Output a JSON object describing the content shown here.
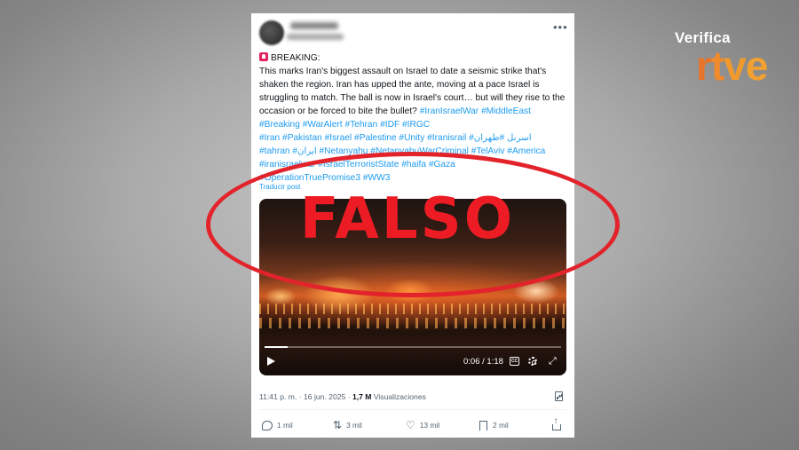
{
  "brand": {
    "verifica": "Verifica",
    "rtve_parts": [
      {
        "text": "r",
        "color": "#e8742a"
      },
      {
        "text": "t",
        "color": "#ef8a2d"
      },
      {
        "text": "v",
        "color": "#f09a2e"
      },
      {
        "text": "e",
        "color": "#f2a030"
      }
    ]
  },
  "tweet": {
    "breaking": "BREAKING:",
    "body": "This marks Iran's biggest assault on Israel to date  a seismic strike that's shaken the region. Iran has upped the ante, moving at a pace Israel is struggling to match. The ball is now in Israel's court… but will they rise to the occasion or be forced to bite the bullet?",
    "inline_tags": "#IranIsraelWar #MiddleEast",
    "tag_lines": [
      "#Breaking #WarAlert #Tehran #IDF #IRGC",
      "#Iran #Pakistan #Israel #Palestine #Unity #Iranisrail #اسرىل #طهران",
      "#tahran #ايران #Netanyahu #NetanyahuWarCriminal #TelAviv #America",
      "#iranisraelwar #IsraelTerroristState #haifa #Gaza",
      "#OperationTruePromise3 #WW3"
    ],
    "translate": "Traducir post",
    "more_icon": "more-dots",
    "video": {
      "time": "0:06 / 1:18",
      "progress": 0.077,
      "cc": "CC"
    },
    "meta": {
      "time_date": "11:41 p. m. · 16 jun. 2025 · ",
      "views_count": "1,7 M",
      "views_label": " Visualizaciones"
    },
    "actions": {
      "replies": "1 mil",
      "reposts": "3 mil",
      "likes": "13 mil",
      "bookmarks": "2 mil"
    }
  },
  "stamp": {
    "label": "FALSO",
    "color": "#ed1c24"
  },
  "colors": {
    "link": "#1d9bf0",
    "secondary_text": "#536471",
    "oval": "#e3232b"
  }
}
